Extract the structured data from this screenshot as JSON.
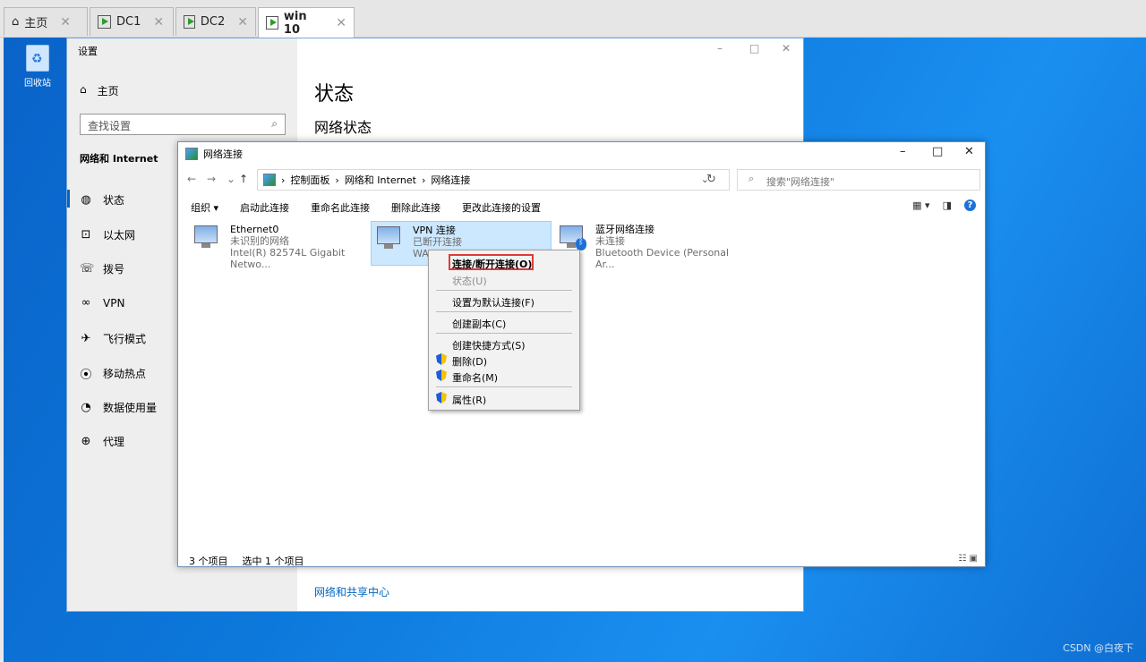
{
  "vm_tabs": [
    {
      "label": "主页",
      "icon": "home-icon"
    },
    {
      "label": "DC1",
      "icon": "vm-icon"
    },
    {
      "label": "DC2",
      "icon": "vm-icon"
    },
    {
      "label": "win 10",
      "icon": "vm-icon",
      "active": true
    }
  ],
  "desktop": {
    "recycle_label": "回收站",
    "watermark": "CSDN @白夜下"
  },
  "settings": {
    "window_title": "设置",
    "controls": {
      "minimize": "–",
      "maximize": "□",
      "close": "✕"
    },
    "home": "主页",
    "search_placeholder": "查找设置",
    "category": "网络和 Internet",
    "nav": [
      {
        "label": "状态",
        "icon": "globe-icon"
      },
      {
        "label": "以太网",
        "icon": "ethernet-icon"
      },
      {
        "label": "拨号",
        "icon": "dialup-icon"
      },
      {
        "label": "VPN",
        "icon": "vpn-icon"
      },
      {
        "label": "飞行模式",
        "icon": "airplane-icon"
      },
      {
        "label": "移动热点",
        "icon": "hotspot-icon"
      },
      {
        "label": "数据使用量",
        "icon": "data-usage-icon"
      },
      {
        "label": "代理",
        "icon": "proxy-icon"
      }
    ],
    "main_title": "状态",
    "main_subtitle": "网络状态",
    "footer_link": "网络和共享中心"
  },
  "netconn": {
    "title": "网络连接",
    "controls": {
      "minimize": "–",
      "maximize": "□",
      "close": "✕"
    },
    "breadcrumb": [
      "控制面板",
      "网络和 Internet",
      "网络连接"
    ],
    "search_placeholder": "搜索\"网络连接\"",
    "toolbar": [
      "组织 ▾",
      "启动此连接",
      "重命名此连接",
      "删除此连接",
      "更改此连接的设置"
    ],
    "connections": [
      {
        "name": "Ethernet0",
        "status": "未识别的网络",
        "device": "Intel(R) 82574L Gigabit Netwo..."
      },
      {
        "name": "VPN 连接",
        "status": "已断开连接",
        "device": "WA"
      },
      {
        "name": "蓝牙网络连接",
        "status": "未连接",
        "device": "Bluetooth Device (Personal Ar..."
      }
    ],
    "status_items": "3 个项目",
    "status_selected": "选中 1 个项目"
  },
  "context_menu": {
    "items": [
      {
        "label": "连接/断开连接(O)",
        "bold": true
      },
      {
        "label": "状态(U)",
        "disabled": true
      },
      {
        "label": "设置为默认连接(F)"
      },
      {
        "label": "创建副本(C)"
      },
      {
        "label": "创建快捷方式(S)"
      },
      {
        "label": "删除(D)",
        "shield": true
      },
      {
        "label": "重命名(M)",
        "shield": true
      },
      {
        "label": "属性(R)",
        "shield": true
      }
    ]
  },
  "colors": {
    "desktop": "#0d78db",
    "accent": "#0067c0",
    "selection": "#cce8ff",
    "highlight_box": "#e03a3a"
  }
}
